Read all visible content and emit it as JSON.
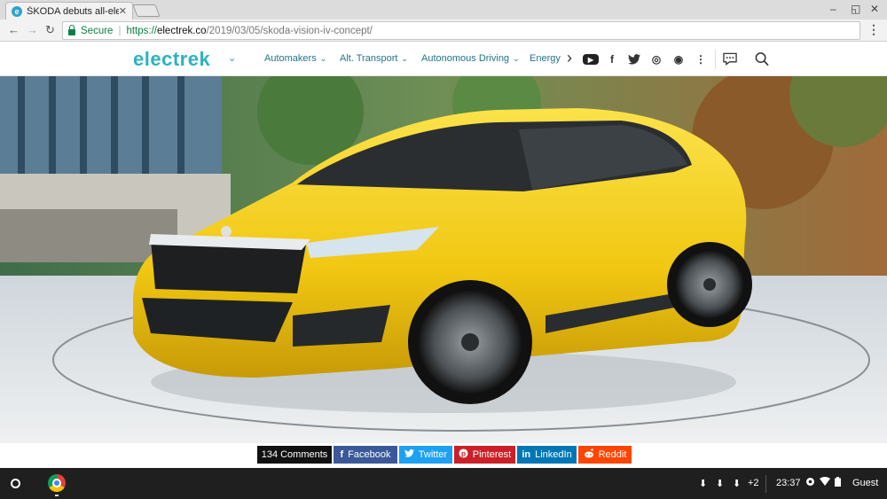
{
  "browser": {
    "tab_title": "ŠKODA debuts all-electric",
    "tab_favicon": "e",
    "close_glyph": "✕",
    "back_glyph": "←",
    "forward_glyph": "→",
    "reload_glyph": "↻",
    "secure_label": "Secure",
    "url_scheme": "https://",
    "url_host": "electrek.co",
    "url_path": "/2019/03/05/skoda-vision-iv-concept/",
    "menu_glyph": "⋮",
    "minimize_glyph": "–",
    "maximize_glyph": "◱",
    "window_close_glyph": "✕"
  },
  "site": {
    "logo": "electrek",
    "nav": [
      "Automakers",
      "Alt. Transport",
      "Autonomous Driving",
      "Energy"
    ],
    "chevron": "⌄",
    "more_glyph": "›",
    "social": {
      "youtube": "▶",
      "facebook": "f",
      "twitter": "t",
      "instagram": "◎",
      "podcast": "◉",
      "more": "⋮",
      "comments": "▭",
      "search": "⌕"
    }
  },
  "hero": {
    "icon": "car-photo",
    "accent": "#f3d11b"
  },
  "share": {
    "comments": "134 Comments",
    "facebook": "Facebook",
    "twitter": "Twitter",
    "pinterest": "Pinterest",
    "linkedin": "LinkedIn",
    "reddit": "Reddit",
    "colors": {
      "comments": "#111111",
      "facebook": "#3b5998",
      "twitter": "#1da1f2",
      "pinterest": "#cb2027",
      "linkedin": "#0077b5",
      "reddit": "#ff4500"
    }
  },
  "shelf": {
    "download_glyph": "⬇",
    "extra_count": "+2",
    "time": "23:37",
    "user": "Guest"
  }
}
